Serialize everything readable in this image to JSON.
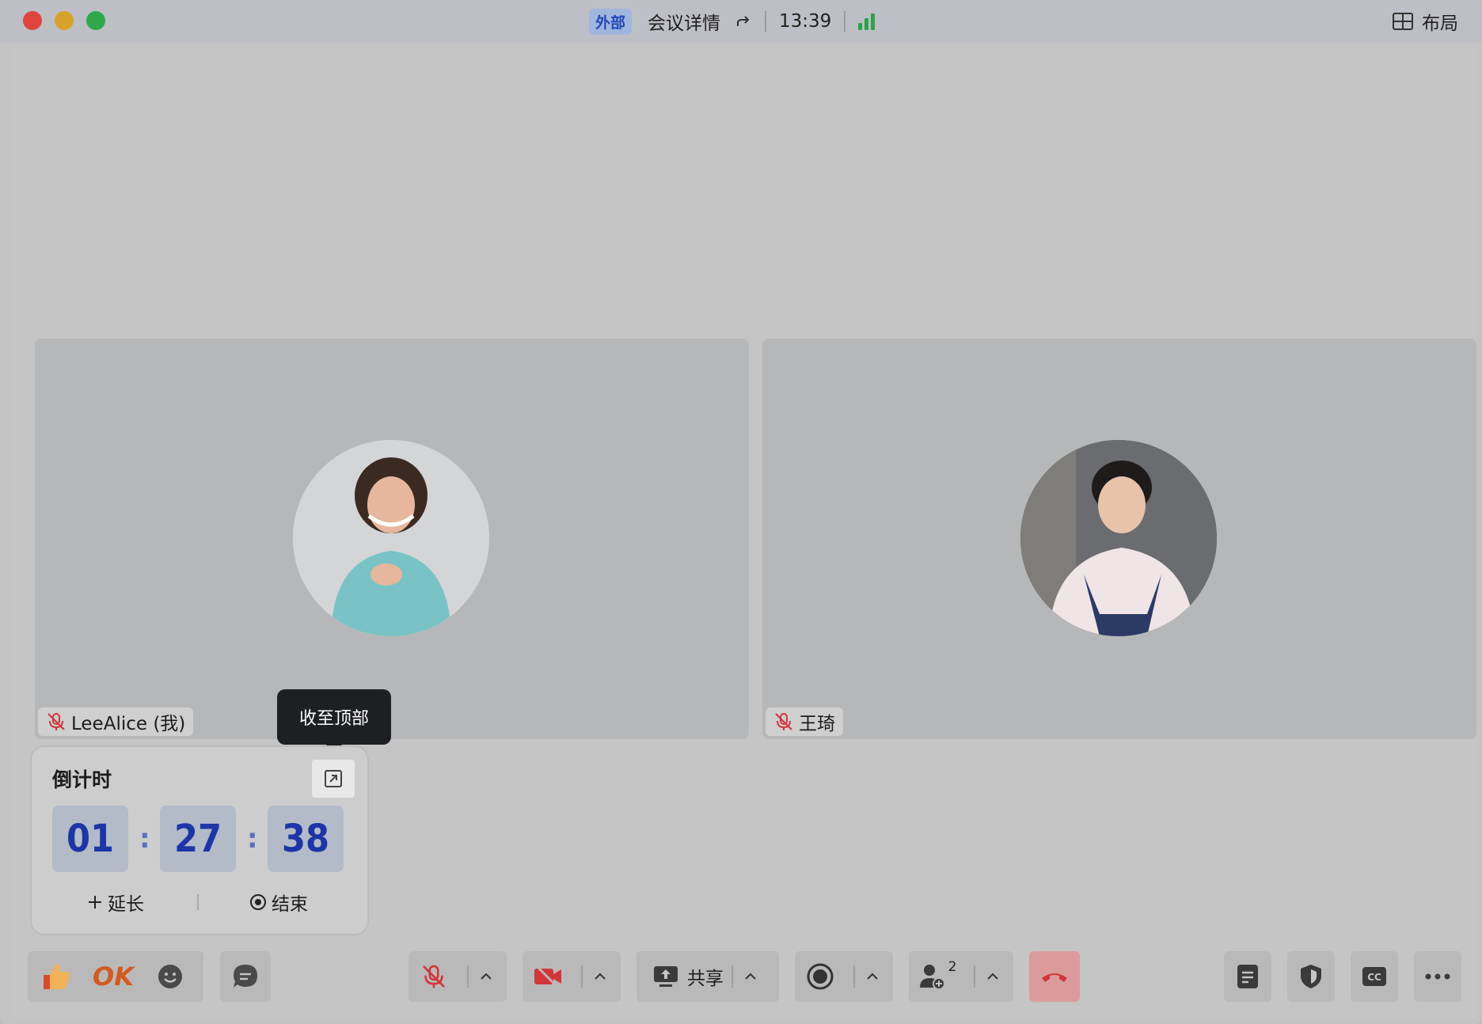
{
  "titlebar": {
    "badge": "外部",
    "meeting_details": "会议详情",
    "time": "13:39",
    "layout_label": "布局"
  },
  "participants": [
    {
      "name": "LeeAlice (我)",
      "muted": true
    },
    {
      "name": "王琦",
      "muted": true
    }
  ],
  "tooltip": {
    "text": "收至顶部"
  },
  "countdown": {
    "title": "倒计时",
    "hours": "01",
    "minutes": "27",
    "seconds": "38",
    "extend_label": "延长",
    "end_label": "结束"
  },
  "toolbar": {
    "reaction_ok": "OK",
    "share_label": "共享",
    "participant_count": "2"
  },
  "colors": {
    "accent_blue": "#1c35a8",
    "signal_green": "#2aa34a",
    "muted_red": "#d2363a",
    "end_call_red": "#d2363a"
  },
  "icons": [
    "refresh-share-icon",
    "signal-icon",
    "layout-grid-icon",
    "mic-off-icon",
    "collapse-to-top-icon",
    "plus-icon",
    "stop-circle-icon",
    "thumbs-up-icon",
    "smile-icon",
    "chat-bubble-icon",
    "camera-off-icon",
    "share-screen-icon",
    "record-icon",
    "add-participant-icon",
    "hang-up-icon",
    "notes-icon",
    "security-shield-icon",
    "captions-icon",
    "more-icon"
  ]
}
